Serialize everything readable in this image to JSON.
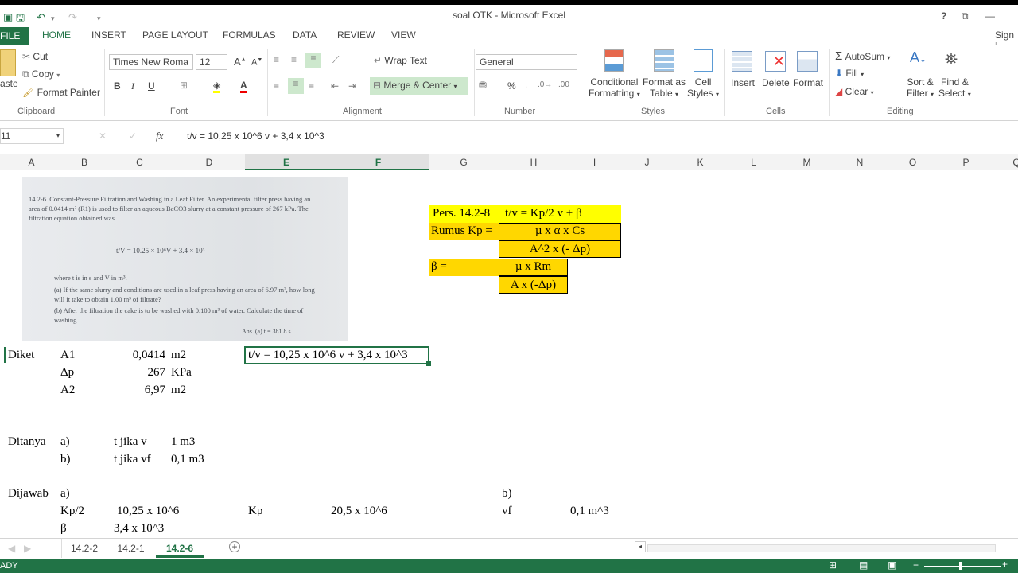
{
  "title": "soal OTK - Microsoft Excel",
  "window": {
    "help": "?",
    "restore": "⧉",
    "minimize": "—",
    "sign_in": "Sign i"
  },
  "tabs": [
    "FILE",
    "HOME",
    "INSERT",
    "PAGE LAYOUT",
    "FORMULAS",
    "DATA",
    "REVIEW",
    "VIEW"
  ],
  "ribbon": {
    "clipboard": {
      "paste": "aste",
      "cut": "Cut",
      "copy": "Copy",
      "format_painter": "Format Painter",
      "group": "Clipboard"
    },
    "font": {
      "family": "Times New Roma",
      "size": "12",
      "bold": "B",
      "italic": "I",
      "underline": "U",
      "grow": "A",
      "shrink": "A",
      "color_a": "A",
      "group": "Font"
    },
    "alignment": {
      "wrap": "Wrap Text",
      "merge": "Merge & Center",
      "group": "Alignment"
    },
    "number": {
      "format": "General",
      "percent": "%",
      "group": "Number"
    },
    "styles": {
      "conditional_1": "Conditional",
      "conditional_2": "Formatting",
      "format_as_1": "Format as",
      "format_as_2": "Table",
      "cell_1": "Cell",
      "cell_2": "Styles",
      "group": "Styles"
    },
    "cells": {
      "insert": "Insert",
      "delete": "Delete",
      "format": "Format",
      "group": "Cells"
    },
    "editing": {
      "autosum": "AutoSum",
      "fill": "Fill",
      "clear": "Clear",
      "sort_1": "Sort &",
      "sort_2": "Filter",
      "find_1": "Find &",
      "find_2": "Select",
      "group": "Editing"
    }
  },
  "formula_bar": {
    "name_box": "11",
    "fx": "fx",
    "formula": "t/v = 10,25 x 10^6 v + 3,4 x 10^3"
  },
  "columns": [
    "A",
    "B",
    "C",
    "D",
    "E",
    "F",
    "G",
    "H",
    "I",
    "J",
    "K",
    "L",
    "M",
    "N",
    "O",
    "P",
    "Q"
  ],
  "image_text": {
    "problem": "14.2-6. Constant-Pressure Filtration and Washing in a Leaf Filter. An experimental filter press having an area of 0.0414 m² (R1) is used to filter an aqueous BaCO3 slurry at a constant pressure of 267 kPa. The filtration equation obtained was",
    "equation": "t/V = 10.25 × 10⁶V + 3.4 × 10³",
    "where": "where t is in s and V in m³.",
    "part_a": "(a) If the same slurry and conditions are used in a leaf press having an area of 6.97 m², how long will it take to obtain 1.00 m³ of filtrate?",
    "part_b": "(b) After the filtration the cake is to be washed with 0.100 m³ of water. Calculate the time of washing.",
    "answer": "Ans. (a) t = 381.8 s"
  },
  "cells": {
    "pers_label": "Pers. 14.2-8",
    "pers_eq": "t/v = Kp/2 v + β",
    "rumus_kp": "Rumus Kp =",
    "kp_num": "µ x α x Cs",
    "kp_den": "A^2 x (- Δp)",
    "beta_label": "β =",
    "beta_num": "µ x Rm",
    "beta_den": "A x (-Δp)",
    "diket": "Diket",
    "a1": "A1",
    "a1_val": "0,0414",
    "a1_unit": "m2",
    "selected_cell": "t/v = 10,25 x 10^6 v + 3,4 x 10^3",
    "dp": "Δp",
    "dp_val": "267",
    "dp_unit": "KPa",
    "a2": "A2",
    "a2_val": "6,97",
    "a2_unit": "m2",
    "ditanya": "Ditanya",
    "q_a": "a)",
    "q_a_text": "t jika v",
    "q_a_val": "1 m3",
    "q_b": "b)",
    "q_b_text": "t jika vf",
    "q_b_val": "0,1 m3",
    "dijawab": "Dijawab",
    "ans_a": "a)",
    "ans_b": "b)",
    "kp2": "Kp/2",
    "kp2_val": "10,25 x 10^6",
    "kp": "Kp",
    "kp_val": "20,5 x 10^6",
    "vf": "vf",
    "vf_val": "0,1 m^3",
    "beta": "β",
    "beta_val": "3,4 x 10^3"
  },
  "sheets": [
    "14.2-2",
    "14.2-1",
    "14.2-6"
  ],
  "active_sheet": "14.2-6",
  "status": "ADY",
  "colors": {
    "excel_green": "#217346",
    "yellow": "#ffd700",
    "bright_yellow": "#ffff00"
  }
}
